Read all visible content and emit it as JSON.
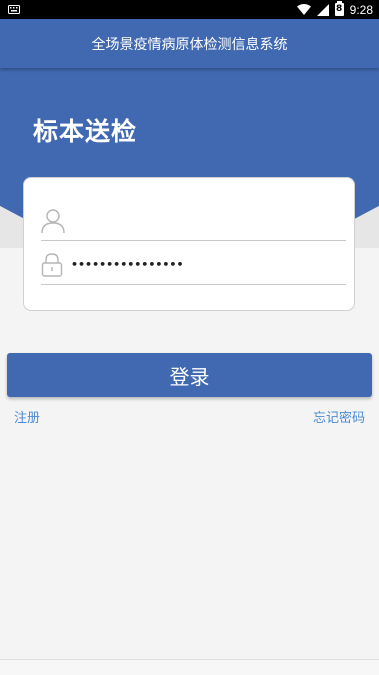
{
  "status_bar": {
    "time": "9:28",
    "battery_level": "8"
  },
  "header": {
    "title": "全场景疫情病原体检测信息系统"
  },
  "hero": {
    "title": "标本送检"
  },
  "login_form": {
    "username": {
      "value": "",
      "icon": "user-icon"
    },
    "password": {
      "value": "••••••••••••••••",
      "icon": "lock-icon"
    }
  },
  "actions": {
    "login_label": "登录",
    "register_label": "注册",
    "forgot_label": "忘记密码"
  },
  "colors": {
    "primary": "#4169b1",
    "link": "#4a8bd6",
    "background": "#f4f4f4"
  }
}
